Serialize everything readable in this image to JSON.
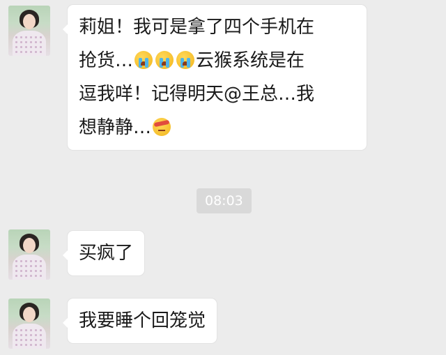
{
  "messages": [
    {
      "sender": "avatar",
      "lines": [
        "莉姐！我可是拿了四个手机在",
        "抢货…",
        "云猴系统是在",
        "逗我咩！记得明天@王总…我",
        "想静静…"
      ],
      "emoji": [
        "crying-face",
        "crying-face",
        "crying-face",
        "headband-face"
      ]
    },
    {
      "sender": "avatar",
      "lines": [
        "买疯了"
      ]
    },
    {
      "sender": "avatar",
      "lines": [
        "我要睡个回笼觉"
      ]
    }
  ],
  "timestamp": "08:03"
}
